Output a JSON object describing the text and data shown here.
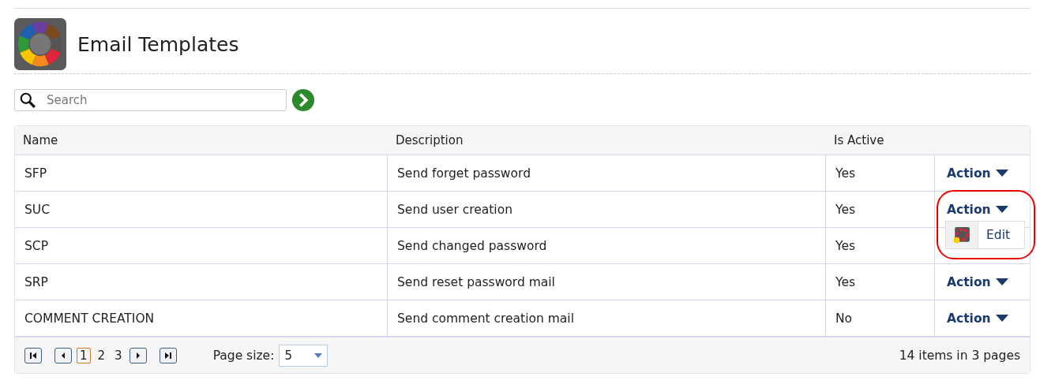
{
  "page": {
    "title": "Email Templates"
  },
  "search": {
    "placeholder": "Search"
  },
  "table": {
    "columns": [
      "Name",
      "Description",
      "Is Active"
    ],
    "rows": [
      {
        "name": "SFP",
        "description": "Send forget password",
        "is_active": "Yes",
        "action": {
          "label": "Action",
          "highlighted": false
        }
      },
      {
        "name": "SUC",
        "description": "Send user creation",
        "is_active": "Yes",
        "action": {
          "label": "Action",
          "highlighted": true,
          "menu": [
            {
              "label": "Edit"
            }
          ]
        }
      },
      {
        "name": "SCP",
        "description": "Send changed password",
        "is_active": "Yes"
      },
      {
        "name": "SRP",
        "description": "Send reset password mail",
        "is_active": "Yes",
        "action": {
          "label": "Action",
          "highlighted": false
        }
      },
      {
        "name": "COMMENT CREATION",
        "description": "Send comment  creation mail",
        "is_active": "No",
        "action": {
          "label": "Action",
          "highlighted": false
        }
      }
    ]
  },
  "pager": {
    "pages": [
      {
        "label": "1",
        "selected": true
      },
      {
        "label": "2",
        "selected": false
      },
      {
        "label": "3",
        "selected": false
      }
    ],
    "page_size_label": "Page size:",
    "page_size": "5",
    "summary": "14 items in 3 pages"
  }
}
